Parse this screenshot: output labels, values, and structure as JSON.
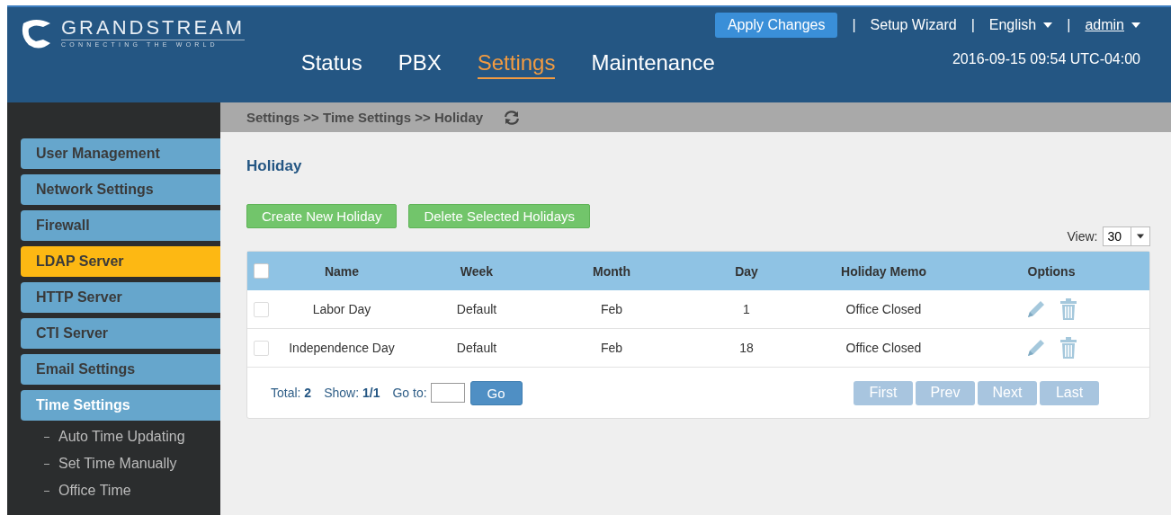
{
  "logo": {
    "name": "GRANDSTREAM",
    "tagline": "CONNECTING THE WORLD"
  },
  "top_links": {
    "apply": "Apply Changes",
    "separator": "|",
    "wizard": "Setup Wizard",
    "language": "English",
    "user": "admin",
    "datetime": "2016-09-15 09:54 UTC-04:00"
  },
  "nav": [
    {
      "label": "Status",
      "selected": false
    },
    {
      "label": "PBX",
      "selected": false
    },
    {
      "label": "Settings",
      "selected": true
    },
    {
      "label": "Maintenance",
      "selected": false
    }
  ],
  "sidebar": {
    "items": [
      {
        "label": "User Management",
        "selected": false,
        "highlighted": false
      },
      {
        "label": "Network Settings",
        "selected": false,
        "highlighted": false
      },
      {
        "label": "Firewall",
        "selected": false,
        "highlighted": false
      },
      {
        "label": "LDAP Server",
        "selected": false,
        "highlighted": true
      },
      {
        "label": "HTTP Server",
        "selected": false,
        "highlighted": false
      },
      {
        "label": "CTI Server",
        "selected": false,
        "highlighted": false
      },
      {
        "label": "Email Settings",
        "selected": false,
        "highlighted": false
      },
      {
        "label": "Time Settings",
        "selected": true,
        "highlighted": false,
        "children": [
          {
            "label": "Auto Time Updating"
          },
          {
            "label": "Set Time Manually"
          },
          {
            "label": "Office Time"
          }
        ]
      }
    ]
  },
  "breadcrumb": "Settings >> Time Settings >> Holiday",
  "page_title": "Holiday",
  "buttons": [
    "Create New Holiday",
    "Delete Selected Holidays"
  ],
  "view": {
    "label": "View:",
    "value": "30"
  },
  "table": {
    "header_checked": false,
    "columns": [
      "Name",
      "Week",
      "Month",
      "Day",
      "Holiday Memo",
      "Options"
    ],
    "rows": [
      {
        "checked": false,
        "cells": [
          "Labor Day",
          "Default",
          "Feb",
          "1",
          "Office Closed"
        ]
      },
      {
        "checked": false,
        "cells": [
          "Independence Day",
          "Default",
          "Feb",
          "18",
          "Office Closed"
        ]
      }
    ]
  },
  "footer": {
    "total_label": "Total:",
    "total": "2",
    "show_label": "Show:",
    "show": "1/1",
    "goto_label": "Go to:",
    "go": "Go",
    "pages": [
      {
        "label": "First",
        "disabled": true
      },
      {
        "label": "Prev",
        "disabled": true
      },
      {
        "label": "Next",
        "disabled": true
      },
      {
        "label": "Last",
        "disabled": true
      }
    ]
  }
}
